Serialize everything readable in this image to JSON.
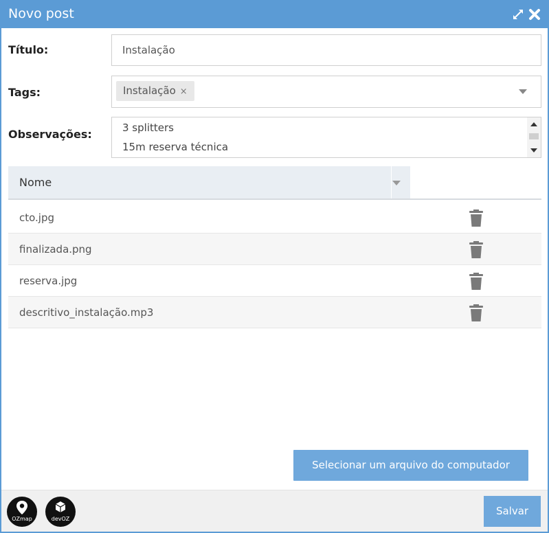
{
  "window": {
    "title": "Novo post"
  },
  "form": {
    "titulo_label": "Título:",
    "titulo_value": "Instalação",
    "tags_label": "Tags:",
    "tags": [
      {
        "label": "Instalação",
        "remove_icon": "×"
      }
    ],
    "observacoes_label": "Observações:",
    "observacoes_lines": [
      "3 splitters",
      "15m reserva técnica"
    ]
  },
  "grid": {
    "column_header": "Nome",
    "rows": [
      {
        "name": "cto.jpg"
      },
      {
        "name": "finalizada.png"
      },
      {
        "name": "reserva.jpg"
      },
      {
        "name": "descritivo_instalação.mp3"
      }
    ]
  },
  "actions": {
    "upload_label": "Selecionar um arquivo do computador",
    "save_label": "Salvar"
  },
  "footer": {
    "logos": [
      {
        "name": "ozmap-logo",
        "text": "OZmap"
      },
      {
        "name": "devoz-logo",
        "text": "devOZ"
      }
    ]
  },
  "colors": {
    "titlebar": "#5b9bd5",
    "button": "#6fa8dc",
    "grid_header": "#e9eef3"
  },
  "icons": [
    "expand-icon",
    "close-icon",
    "tag-remove-icon",
    "dropdown-caret-icon",
    "scroll-up-icon",
    "scroll-down-icon",
    "trash-icon"
  ]
}
